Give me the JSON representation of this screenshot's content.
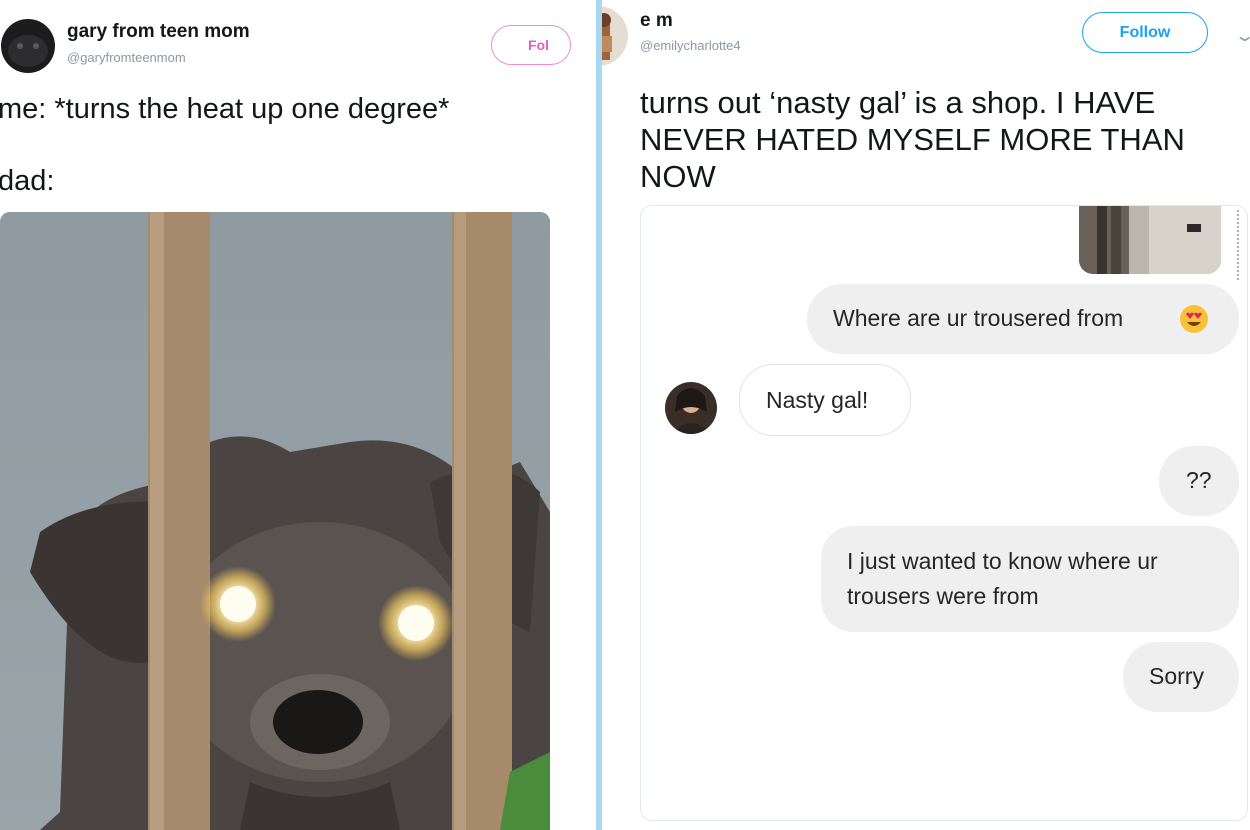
{
  "left_tweet": {
    "display_name": "gary from teen mom",
    "handle": "@garyfromteenmom",
    "follow_label": "Fol",
    "line1": "me: *turns the heat up one degree*",
    "line2": "dad:"
  },
  "right_tweet": {
    "display_name": "e m",
    "handle": "@emilycharlotte4",
    "follow_label": "Follow",
    "text": "turns out ‘nasty gal’ is a shop. I HAVE NEVER HATED MYSELF MORE THAN NOW",
    "messages": [
      {
        "text": "Where are ur trousered from",
        "sender": "me",
        "emoji": "heart-eyes-emoji"
      },
      {
        "text": "Nasty gal!",
        "sender": "other"
      },
      {
        "text": "??",
        "sender": "me"
      },
      {
        "text": "I just wanted to know where ur trousers were from",
        "sender": "me"
      },
      {
        "text": "Sorry",
        "sender": "me"
      }
    ]
  },
  "icons": {
    "chevron": "chevron-down-icon"
  },
  "colors": {
    "divider": "#a7d8f0",
    "follow_blue": "#1da1f2",
    "follow_pink": "#e060c0",
    "sent_bubble": "#efefef"
  }
}
